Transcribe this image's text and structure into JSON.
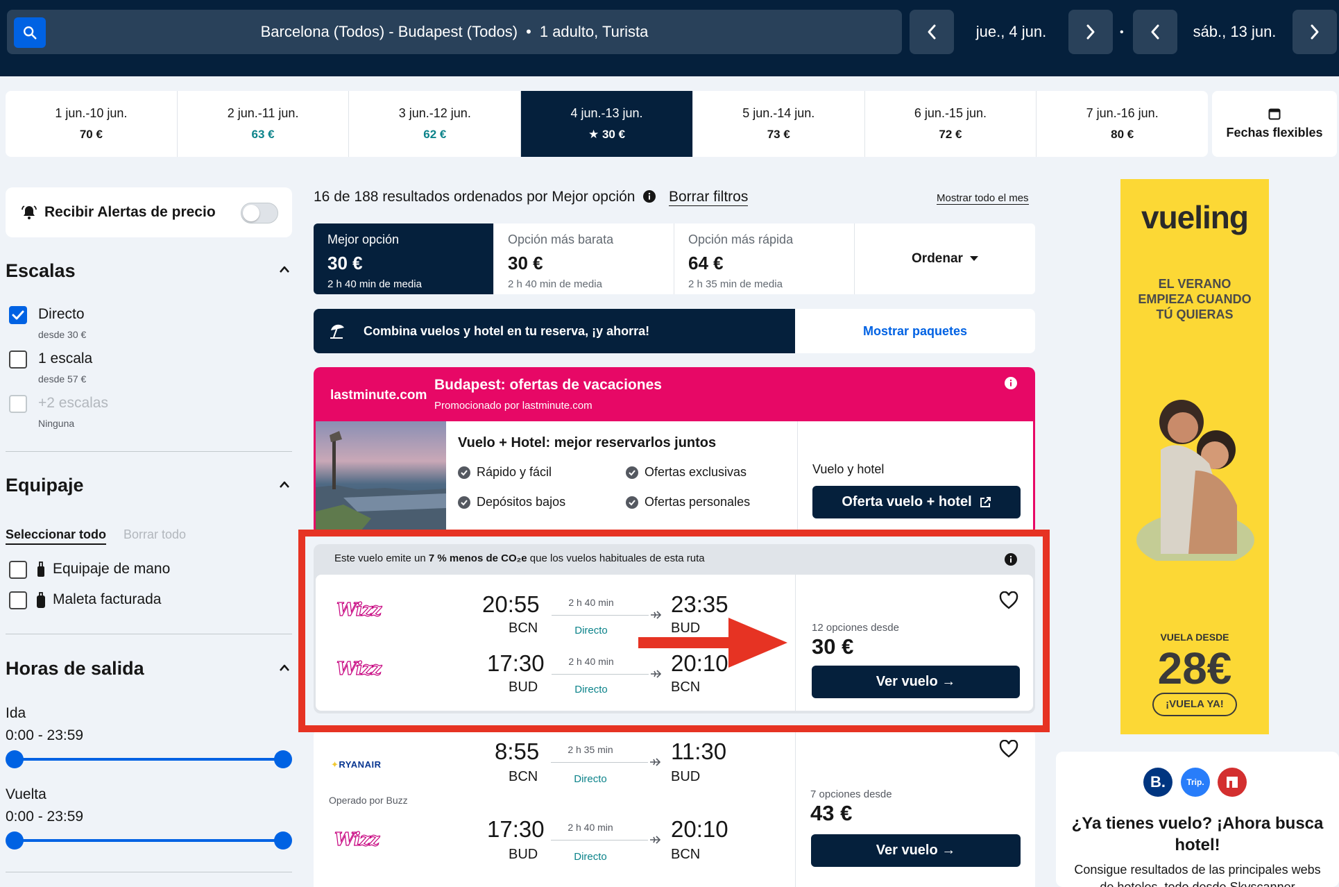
{
  "header": {
    "route": "Barcelona (Todos) - Budapest (Todos)",
    "separator": "•",
    "passengers": "1 adulto, Turista",
    "outbound_date": "jue., 4 jun.",
    "return_date": "sáb., 13 jun.",
    "dot": "•"
  },
  "date_strip": [
    {
      "dates": "1 jun.-10 jun.",
      "price": "70 €"
    },
    {
      "dates": "2 jun.-11 jun.",
      "price": "63 €"
    },
    {
      "dates": "3 jun.-12 jun.",
      "price": "62 €"
    },
    {
      "dates": "4 jun.-13 jun.",
      "price": "★ 30 €"
    },
    {
      "dates": "5 jun.-14 jun.",
      "price": "73 €"
    },
    {
      "dates": "6 jun.-15 jun.",
      "price": "72 €"
    },
    {
      "dates": "7 jun.-16 jun.",
      "price": "80 €"
    }
  ],
  "flex_dates_label": "Fechas flexibles",
  "sidebar": {
    "alert_label": "Recibir Alertas de precio",
    "stops": {
      "title": "Escalas",
      "items": [
        {
          "label": "Directo",
          "sub": "desde 30 €",
          "checked": true
        },
        {
          "label": "1 escala",
          "sub": "desde 57 €",
          "checked": false
        },
        {
          "label": "+2 escalas",
          "sub": "Ninguna",
          "checked": false,
          "disabled": true
        }
      ]
    },
    "baggage": {
      "title": "Equipaje",
      "select_all": "Seleccionar todo",
      "clear_all": "Borrar todo",
      "items": [
        {
          "label": "Equipaje de mano"
        },
        {
          "label": "Maleta facturada"
        }
      ]
    },
    "departure": {
      "title": "Horas de salida",
      "outbound_label": "Ida",
      "outbound_range": "0:00 - 23:59",
      "return_label": "Vuelta",
      "return_range": "0:00 - 23:59"
    }
  },
  "results": {
    "summary": "16 de 188 resultados ordenados por Mejor opción",
    "clear_filters": "Borrar filtros",
    "show_month": "Mostrar todo el mes",
    "tabs": [
      {
        "title": "Mejor opción",
        "price": "30 €",
        "sub": "2 h 40 min de media"
      },
      {
        "title": "Opción más barata",
        "price": "30 €",
        "sub": "2 h 40 min de media"
      },
      {
        "title": "Opción más rápida",
        "price": "64 €",
        "sub": "2 h 35 min de media"
      }
    ],
    "sort_label": "Ordenar"
  },
  "package_banner": {
    "text": "Combina vuelos y hotel en tu reserva, ¡y ahorra!",
    "button": "Mostrar paquetes"
  },
  "promo": {
    "brand": "lastminute.com",
    "title": "Budapest: ofertas de vacaciones",
    "subtitle": "Promocionado por lastminute.com",
    "headline": "Vuelo + Hotel: mejor reservarlos juntos",
    "features": [
      "Rápido y fácil",
      "Ofertas exclusivas",
      "Depósitos bajos",
      "Ofertas personales"
    ],
    "side_label": "Vuelo y hotel",
    "button": "Oferta vuelo + hotel"
  },
  "flight1": {
    "co2_note_pre": "Este vuelo emite un ",
    "co2_note_bold": "7 % menos de CO₂e",
    "co2_note_post": " que los vuelos habituales de esta ruta",
    "legs": [
      {
        "airline": "Wizz",
        "dep": "20:55",
        "dep_code": "BCN",
        "dur": "2 h 40 min",
        "type": "Directo",
        "arr": "23:35",
        "arr_code": "BUD"
      },
      {
        "airline": "Wizz",
        "dep": "17:30",
        "dep_code": "BUD",
        "dur": "2 h 40 min",
        "type": "Directo",
        "arr": "20:10",
        "arr_code": "BCN"
      }
    ],
    "options": "12 opciones desde",
    "price": "30 €",
    "button": "Ver vuelo →"
  },
  "flight2": {
    "legs": [
      {
        "airline": "RYANAIR",
        "dep": "8:55",
        "dep_code": "BCN",
        "dur": "2 h 35 min",
        "type": "Directo",
        "arr": "11:30",
        "arr_code": "BUD"
      },
      {
        "airline": "Wizz",
        "dep": "17:30",
        "dep_code": "BUD",
        "dur": "2 h 40 min",
        "type": "Directo",
        "arr": "20:10",
        "arr_code": "BCN"
      }
    ],
    "operated_by": "Operado por Buzz",
    "options": "7 opciones desde",
    "price": "43 €",
    "button": "Ver vuelo →"
  },
  "vueling_ad": {
    "brand": "vueling",
    "headline": "EL VERANO EMPIEZA CUANDO TÚ QUIERAS",
    "from": "VUELA DESDE",
    "price": "28€",
    "cta": "¡VUELA YA!"
  },
  "hotel_card": {
    "logos": [
      "B.",
      "Trip."
    ],
    "title": "¿Ya tienes vuelo? ¡Ahora busca hotel!",
    "body": "Consigue resultados de las principales webs de hoteles, todo desde Skyscanner"
  },
  "colors": {
    "navy": "#05203c",
    "blue": "#0062e3",
    "teal": "#0c838a",
    "pink": "#e70866",
    "highlight": "#e63323",
    "vueling": "#fcd835"
  },
  "annotation": {
    "type": "highlight box + arrow",
    "color": "#e63323"
  }
}
